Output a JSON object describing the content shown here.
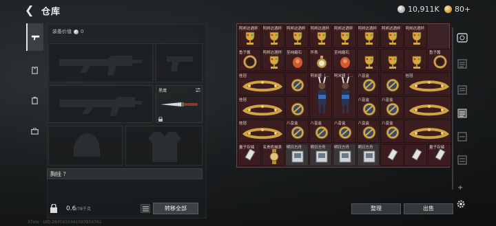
{
  "header": {
    "title": "仓库",
    "silver": "10,911K",
    "gold": "80+"
  },
  "panel": {
    "equip_value_label": "装备价值",
    "equip_value": "0",
    "knife_label": "黑鹰",
    "chest_label": "胸挂 ？",
    "weight_value": "0.6",
    "weight_max": "/78千克",
    "transfer_all": "转移全部"
  },
  "grid": {
    "row1": [
      "阿邦达酒杯",
      "阿邦达酒杯",
      "阿邦达酒杯",
      "阿邦达酒杯",
      "阿邦达酒杯",
      "阿邦达酒杯",
      "阿邦达酒杯",
      "阿邦达酒杯"
    ],
    "row2": [
      "鱼子酱",
      "阿邦达酒杯",
      "至纯霜石",
      "怀表",
      "至纯霜石",
      "鱼子酱"
    ],
    "row3": [
      "桂冠",
      "阿米娅（...",
      "阿米娅（...",
      "八音盒",
      "桂冠"
    ],
    "row4": [
      "桂冠",
      "八音盒",
      "八音盒"
    ],
    "row5": [
      "桂冠",
      "八音盒",
      "八音盒",
      "八音盒",
      "八音盒",
      "八音盒"
    ],
    "row6": [
      "量子存储",
      "名贵机械表",
      "明日方舟",
      "明日方舟",
      "明日方舟",
      "明日方舟",
      "量子存储"
    ]
  },
  "actions": {
    "sort": "整理",
    "sell": "出售"
  },
  "footer": "37ms  ·  UID:2835933341093954761"
}
